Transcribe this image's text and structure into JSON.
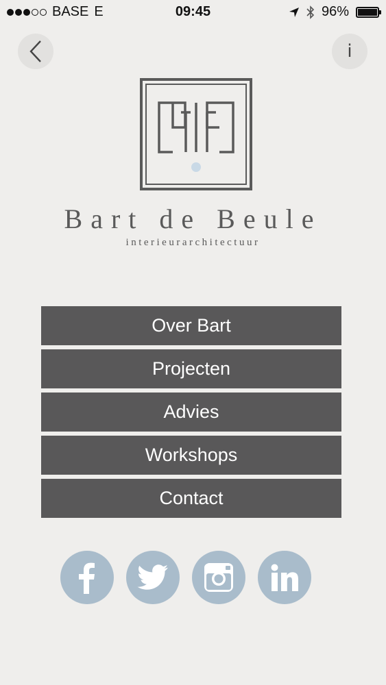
{
  "status_bar": {
    "carrier": "BASE",
    "network": "E",
    "time": "09:45",
    "battery": "96%",
    "battery_level": 0.96
  },
  "nav": {
    "back_icon": "chevron-left-icon",
    "info_label": "i"
  },
  "brand": {
    "name": "Bart de Beule",
    "subtitle": "interieurarchitectuur"
  },
  "menu": {
    "items": [
      {
        "label": "Over Bart"
      },
      {
        "label": "Projecten"
      },
      {
        "label": "Advies"
      },
      {
        "label": "Workshops"
      },
      {
        "label": "Contact"
      }
    ]
  },
  "social": {
    "icons": [
      "facebook-icon",
      "twitter-icon",
      "instagram-icon",
      "linkedin-icon"
    ]
  },
  "colors": {
    "background": "#efeeec",
    "menu_button": "#595859",
    "social_circle": "#a9bccb",
    "logo_accent": "#c9d9e6"
  }
}
